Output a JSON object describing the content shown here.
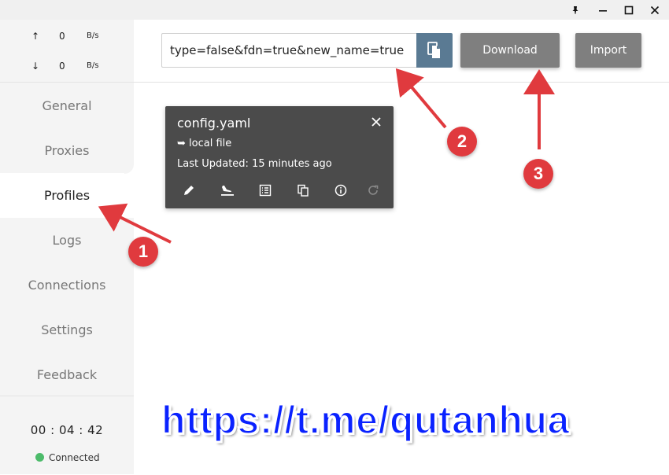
{
  "window": {
    "controls": {
      "pin": "pin-icon",
      "minimize": "minimize-icon",
      "maximize": "maximize-icon",
      "close": "close-icon"
    }
  },
  "traffic": {
    "up": {
      "arrow": "↑",
      "value": "0",
      "unit": "B/s"
    },
    "down": {
      "arrow": "↓",
      "value": "0",
      "unit": "B/s"
    }
  },
  "sidebar": {
    "items": [
      {
        "label": "General"
      },
      {
        "label": "Proxies"
      },
      {
        "label": "Profiles",
        "active": true
      },
      {
        "label": "Logs"
      },
      {
        "label": "Connections"
      },
      {
        "label": "Settings"
      },
      {
        "label": "Feedback"
      }
    ]
  },
  "status": {
    "timer": "00 : 04 : 42",
    "connection": "Connected",
    "connection_color": "#4cbb6a"
  },
  "toolbar": {
    "url_value": "type=false&fdn=true&new_name=true",
    "download_label": "Download",
    "import_label": "Import"
  },
  "profile_card": {
    "name": "config.yaml",
    "type": "➥ local file",
    "updated": "Last Updated: 15 minutes ago",
    "actions": [
      "edit-icon",
      "flight-land-icon",
      "list-icon",
      "copy-icon",
      "info-icon",
      "refresh-icon"
    ]
  },
  "annotations": {
    "badges": [
      "1",
      "2",
      "3"
    ],
    "accent_color": "#e03a3e",
    "watermark": "https://t.me/qutanhua"
  }
}
